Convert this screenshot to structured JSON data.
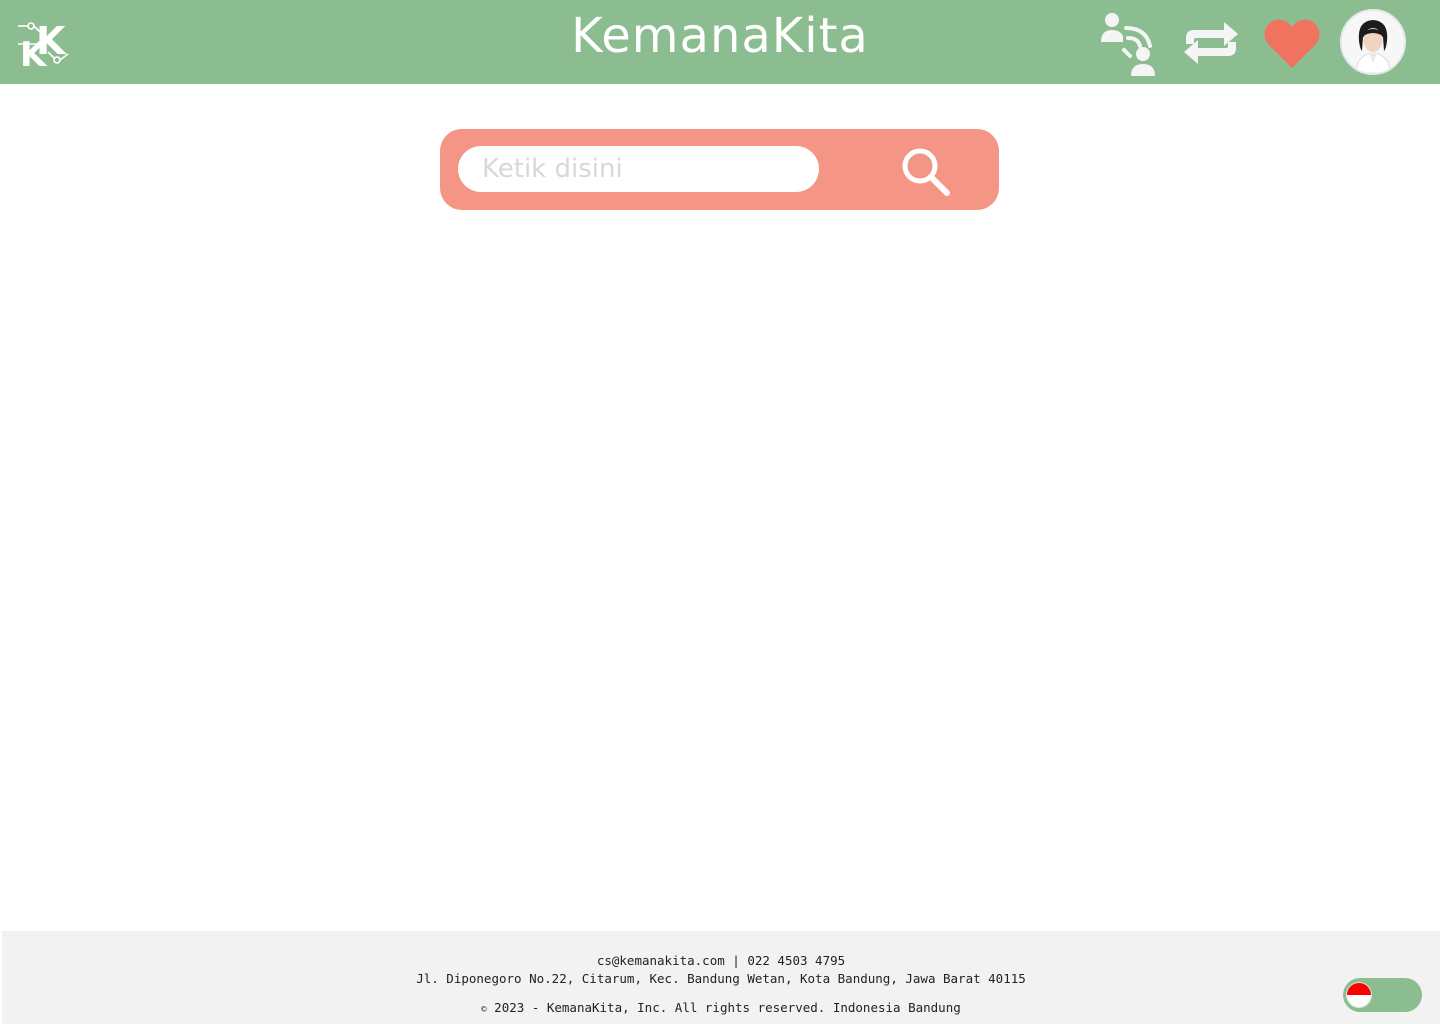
{
  "header": {
    "title": "KemanaKita",
    "logo_text": "K",
    "icons": [
      "users-connect-icon",
      "swap-arrows-icon",
      "heart-icon",
      "avatar"
    ]
  },
  "search": {
    "placeholder": "Ketik disini",
    "value": ""
  },
  "footer": {
    "contact": "cs@kemanakita.com | 022 4503 4795",
    "address": "Jl. Diponegoro No.22, Citarum, Kec. Bandung Wetan, Kota Bandung, Jawa Barat 40115",
    "copyright_symbol": "©",
    "copyright": "2023 - KemanaKita, Inc. All rights reserved. Indonesia Bandung"
  },
  "language_toggle": {
    "selected": "Indonesia"
  },
  "colors": {
    "header_bg": "#8bbd90",
    "search_bg": "#f49585",
    "heart": "#f07360",
    "footer_bg": "#f2f2f2"
  }
}
